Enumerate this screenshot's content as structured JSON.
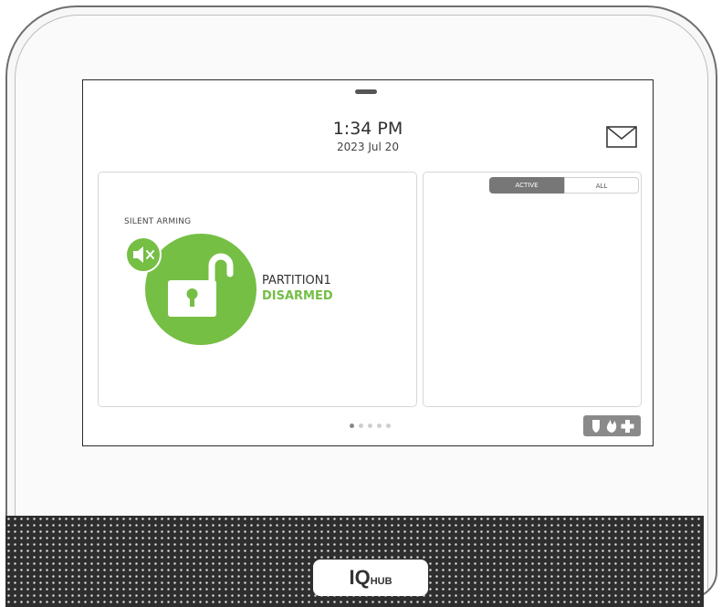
{
  "status": {
    "time": "1:34 PM",
    "date": "2023 Jul 20"
  },
  "partition": {
    "silent_arming_label": "SILENT ARMING",
    "name": "PARTITION1",
    "state": "DISARMED",
    "state_color": "#75bf45"
  },
  "events": {
    "tabs": [
      {
        "label": "ACTIVE"
      },
      {
        "label": "ALL"
      }
    ]
  },
  "pager": {
    "count": 5,
    "active_index": 0
  },
  "icons": {
    "message": "envelope-icon",
    "mute": "speaker-mute-icon",
    "lock": "unlocked-padlock-icon",
    "emergency": [
      "police-shield-icon",
      "fire-icon",
      "medical-cross-icon"
    ]
  },
  "brand": {
    "logo_main": "IQ",
    "logo_sub": "HUB"
  }
}
